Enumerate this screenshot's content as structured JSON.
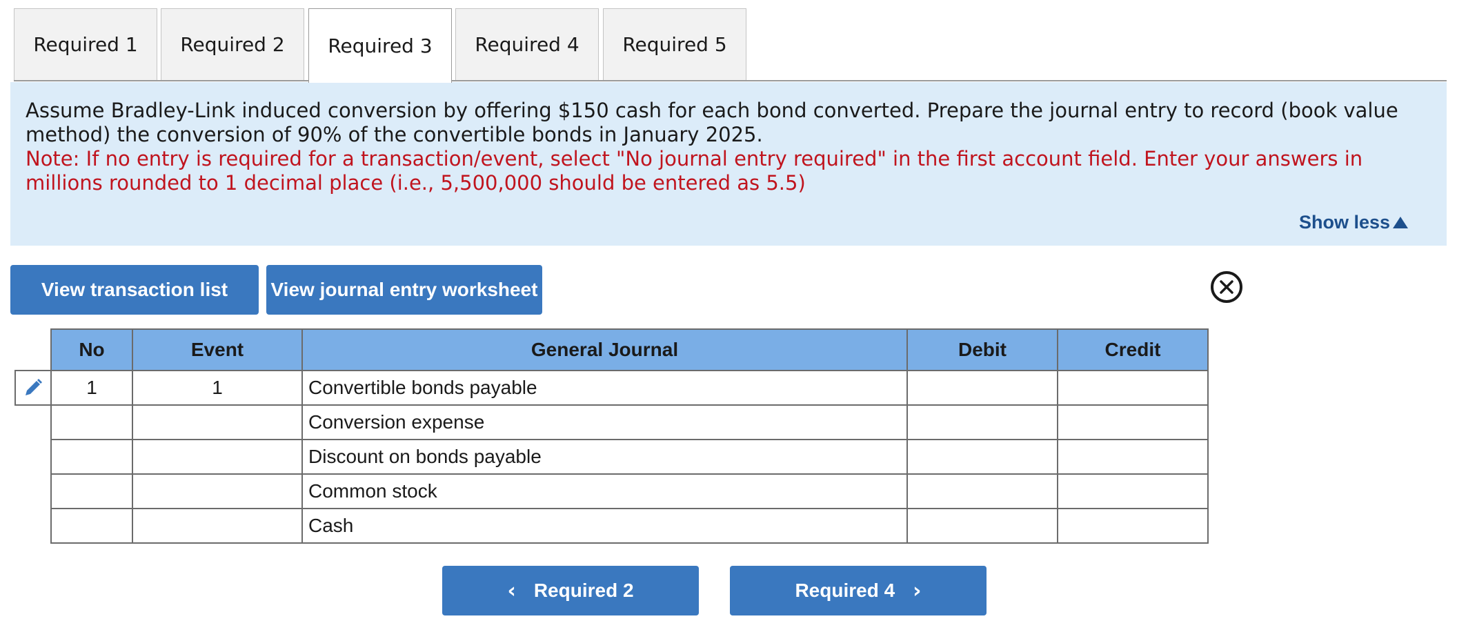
{
  "tabs": [
    {
      "label": "Required 1",
      "active": false
    },
    {
      "label": "Required 2",
      "active": false
    },
    {
      "label": "Required 3",
      "active": true
    },
    {
      "label": "Required 4",
      "active": false
    },
    {
      "label": "Required 5",
      "active": false
    }
  ],
  "instructions": {
    "main": "Assume Bradley-Link induced conversion by offering $150 cash for each bond converted. Prepare the journal entry to record (book value method) the conversion of 90% of the convertible bonds in January 2025.",
    "note": "Note: If no entry is required for a transaction/event, select \"No journal entry required\" in the first account field. Enter your answers in millions rounded to 1 decimal place (i.e., 5,500,000 should be entered as 5.5)",
    "show_less": "Show less"
  },
  "buttons": {
    "view_transaction_list": "View transaction list",
    "view_journal_worksheet": "View journal entry worksheet"
  },
  "journal": {
    "headers": {
      "no": "No",
      "event": "Event",
      "general_journal": "General Journal",
      "debit": "Debit",
      "credit": "Credit"
    },
    "rows": [
      {
        "no": "1",
        "event": "1",
        "account": "Convertible bonds payable",
        "debit": "",
        "credit": ""
      },
      {
        "no": "",
        "event": "",
        "account": "Conversion expense",
        "debit": "",
        "credit": ""
      },
      {
        "no": "",
        "event": "",
        "account": "Discount on bonds payable",
        "debit": "",
        "credit": ""
      },
      {
        "no": "",
        "event": "",
        "account": "Common stock",
        "debit": "",
        "credit": ""
      },
      {
        "no": "",
        "event": "",
        "account": "Cash",
        "debit": "",
        "credit": ""
      }
    ]
  },
  "nav": {
    "prev_label": "Required 2",
    "next_label": "Required 4"
  },
  "colors": {
    "accent": "#3a78bf",
    "header_blue": "#7aaee6",
    "instruction_bg": "#dcecf9",
    "note_red": "#c0141e"
  },
  "icons": [
    "pencil-icon",
    "close-circle-icon",
    "triangle-up-icon",
    "chevron-left-icon",
    "chevron-right-icon"
  ]
}
